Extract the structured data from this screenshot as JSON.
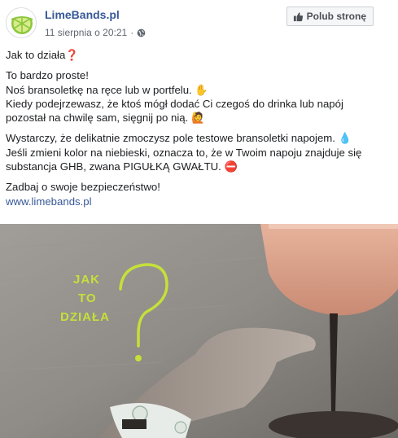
{
  "header": {
    "page_name": "LimeBands.pl",
    "timestamp": "11 sierpnia o 20:21",
    "like_button": "Polub stronę"
  },
  "post": {
    "line1": "Jak to działa❓",
    "line2": "To bardzo proste!",
    "line3": "Noś bransoletkę na ręce lub w portfelu. ✋",
    "line4": "Kiedy podejrzewasz, że ktoś mógł dodać Ci czegoś do drinka lub napój",
    "line5": "pozostał na chwilę sam, sięgnij po nią. 🙋",
    "line6": "Wystarczy, że delikatnie zmoczysz pole testowe bransoletki napojem. 💧",
    "line7": "Jeśli zmieni kolor na niebieski, oznacza to, że w Twoim napoju znajduje się",
    "line8": "substancja GHB, zwana PIGUŁKĄ GWAŁTU. ⛔",
    "line9": "Zadbaj o swoje bezpieczeństwo!",
    "link": "www.limebands.pl"
  },
  "image": {
    "word1": "JAK",
    "word2": "TO",
    "word3": "DZIAŁA"
  },
  "colors": {
    "brand_link": "#385898",
    "lime": "#c5e03a",
    "text": "#1c1e21",
    "meta": "#606770"
  }
}
